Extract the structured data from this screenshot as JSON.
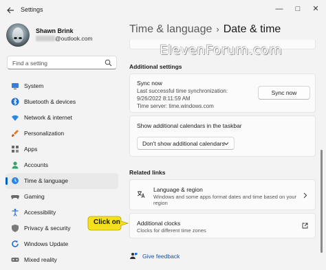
{
  "window": {
    "title": "Settings",
    "minimize_glyph": "—",
    "maximize_glyph": "□",
    "close_glyph": "✕"
  },
  "user": {
    "name": "Shawn Brink",
    "email_suffix": "@outlook.com"
  },
  "search": {
    "placeholder": "Find a setting"
  },
  "sidebar": {
    "items": [
      {
        "label": "System",
        "icon": "monitor-icon",
        "color": "#3a7bd5"
      },
      {
        "label": "Bluetooth & devices",
        "icon": "bluetooth-icon",
        "color": "#1f6fd1"
      },
      {
        "label": "Network & internet",
        "icon": "wifi-icon",
        "color": "#2c87e0"
      },
      {
        "label": "Personalization",
        "icon": "brush-icon",
        "color": "#e07b2c"
      },
      {
        "label": "Apps",
        "icon": "apps-icon",
        "color": "#6b6b6b"
      },
      {
        "label": "Accounts",
        "icon": "person-icon",
        "color": "#2fa36b"
      },
      {
        "label": "Time & language",
        "icon": "globe-clock-icon",
        "color": "#2c87e0",
        "active": true
      },
      {
        "label": "Gaming",
        "icon": "controller-icon",
        "color": "#6b6b6b"
      },
      {
        "label": "Accessibility",
        "icon": "accessibility-icon",
        "color": "#2c6fd1"
      },
      {
        "label": "Privacy & security",
        "icon": "shield-icon",
        "color": "#7a7a7a"
      },
      {
        "label": "Windows Update",
        "icon": "update-icon",
        "color": "#1f6fd1"
      },
      {
        "label": "Mixed reality",
        "icon": "headset-icon",
        "color": "#6b6b6b"
      }
    ]
  },
  "breadcrumb": {
    "parent": "Time & language",
    "separator": "›",
    "current": "Date & time"
  },
  "watermark": "ElevenForum.com",
  "additional_settings": {
    "heading": "Additional settings",
    "sync": {
      "title": "Sync now",
      "last_sync_label": "Last successful time synchronization:",
      "last_sync_value": "9/26/2022 8:11:59 AM",
      "time_server": "Time server: time.windows.com",
      "button": "Sync now"
    },
    "calendars": {
      "title": "Show additional calendars in the taskbar",
      "selected": "Don't show additional calendars"
    }
  },
  "related_links": {
    "heading": "Related links",
    "language_region": {
      "title": "Language & region",
      "desc_line1": "Windows and some apps format dates and time based on your",
      "desc_line2": "region"
    },
    "additional_clocks": {
      "title": "Additional clocks",
      "desc": "Clocks for different time zones"
    }
  },
  "callout": {
    "text": "Click on",
    "color": "#f5e11b"
  },
  "feedback": {
    "label": "Give feedback"
  },
  "colors": {
    "accent": "#005fb8",
    "background": "#f3f3f3",
    "card": "#fbfbfb"
  }
}
